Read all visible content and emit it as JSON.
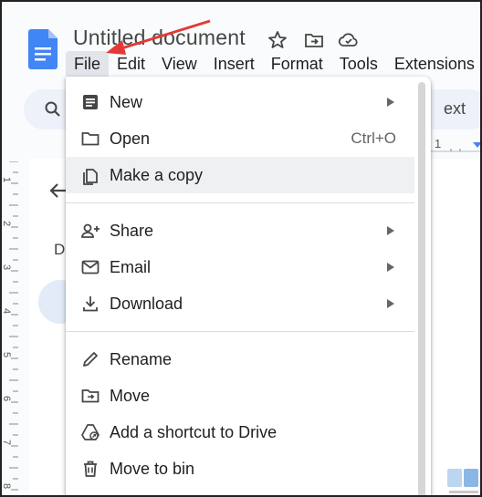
{
  "document": {
    "title": "Untitled document"
  },
  "menubar": {
    "items": [
      {
        "label": "File",
        "active": true
      },
      {
        "label": "Edit"
      },
      {
        "label": "View"
      },
      {
        "label": "Insert"
      },
      {
        "label": "Format"
      },
      {
        "label": "Tools"
      },
      {
        "label": "Extensions"
      }
    ]
  },
  "toolbar": {
    "partial_text": "ext"
  },
  "sidebar": {
    "letter": "D"
  },
  "ruler": {
    "h_label": "1"
  },
  "ruler_v": {
    "labels": [
      "1",
      "2",
      "3",
      "4",
      "5",
      "6",
      "7",
      "8"
    ]
  },
  "file_menu": {
    "items": [
      {
        "label": "New",
        "icon": "doc-icon",
        "submenu": true
      },
      {
        "label": "Open",
        "icon": "folder-icon",
        "shortcut": "Ctrl+O"
      },
      {
        "label": "Make a copy",
        "icon": "copy-icon",
        "hovered": true
      },
      {
        "label": "Share",
        "icon": "person-add-icon",
        "submenu": true
      },
      {
        "label": "Email",
        "icon": "mail-icon",
        "submenu": true
      },
      {
        "label": "Download",
        "icon": "download-icon",
        "submenu": true
      },
      {
        "label": "Rename",
        "icon": "pencil-icon"
      },
      {
        "label": "Move",
        "icon": "folder-move-icon"
      },
      {
        "label": "Add a shortcut to Drive",
        "icon": "drive-shortcut-icon"
      },
      {
        "label": "Move to bin",
        "icon": "trash-icon"
      }
    ]
  },
  "colors": {
    "accent": "#4285f4",
    "annotation": "#e53935",
    "hover": "#eef0f2"
  }
}
